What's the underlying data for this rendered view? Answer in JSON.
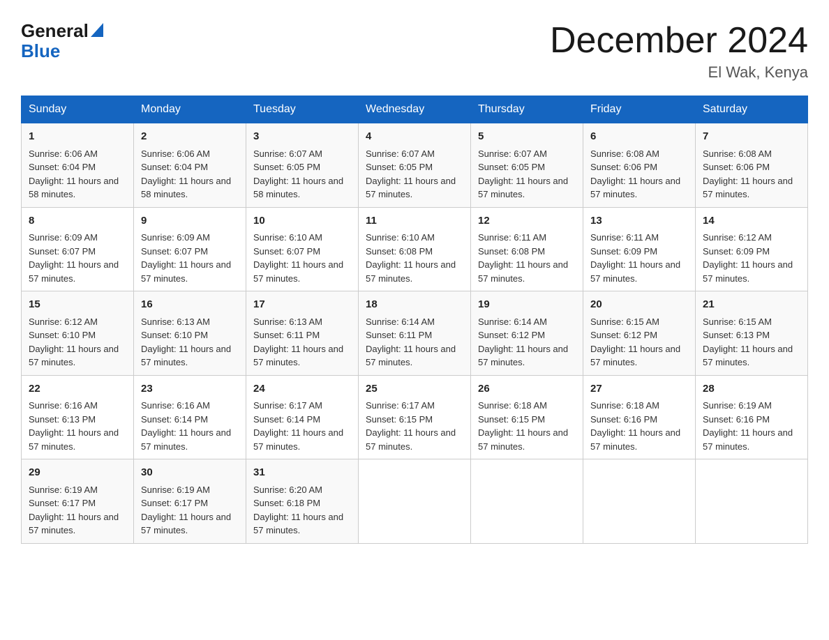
{
  "logo": {
    "general": "General",
    "triangle": "▲",
    "blue": "Blue"
  },
  "title": "December 2024",
  "location": "El Wak, Kenya",
  "days_of_week": [
    "Sunday",
    "Monday",
    "Tuesday",
    "Wednesday",
    "Thursday",
    "Friday",
    "Saturday"
  ],
  "weeks": [
    [
      {
        "day": "1",
        "sunrise": "6:06 AM",
        "sunset": "6:04 PM",
        "daylight": "11 hours and 58 minutes."
      },
      {
        "day": "2",
        "sunrise": "6:06 AM",
        "sunset": "6:04 PM",
        "daylight": "11 hours and 58 minutes."
      },
      {
        "day": "3",
        "sunrise": "6:07 AM",
        "sunset": "6:05 PM",
        "daylight": "11 hours and 58 minutes."
      },
      {
        "day": "4",
        "sunrise": "6:07 AM",
        "sunset": "6:05 PM",
        "daylight": "11 hours and 57 minutes."
      },
      {
        "day": "5",
        "sunrise": "6:07 AM",
        "sunset": "6:05 PM",
        "daylight": "11 hours and 57 minutes."
      },
      {
        "day": "6",
        "sunrise": "6:08 AM",
        "sunset": "6:06 PM",
        "daylight": "11 hours and 57 minutes."
      },
      {
        "day": "7",
        "sunrise": "6:08 AM",
        "sunset": "6:06 PM",
        "daylight": "11 hours and 57 minutes."
      }
    ],
    [
      {
        "day": "8",
        "sunrise": "6:09 AM",
        "sunset": "6:07 PM",
        "daylight": "11 hours and 57 minutes."
      },
      {
        "day": "9",
        "sunrise": "6:09 AM",
        "sunset": "6:07 PM",
        "daylight": "11 hours and 57 minutes."
      },
      {
        "day": "10",
        "sunrise": "6:10 AM",
        "sunset": "6:07 PM",
        "daylight": "11 hours and 57 minutes."
      },
      {
        "day": "11",
        "sunrise": "6:10 AM",
        "sunset": "6:08 PM",
        "daylight": "11 hours and 57 minutes."
      },
      {
        "day": "12",
        "sunrise": "6:11 AM",
        "sunset": "6:08 PM",
        "daylight": "11 hours and 57 minutes."
      },
      {
        "day": "13",
        "sunrise": "6:11 AM",
        "sunset": "6:09 PM",
        "daylight": "11 hours and 57 minutes."
      },
      {
        "day": "14",
        "sunrise": "6:12 AM",
        "sunset": "6:09 PM",
        "daylight": "11 hours and 57 minutes."
      }
    ],
    [
      {
        "day": "15",
        "sunrise": "6:12 AM",
        "sunset": "6:10 PM",
        "daylight": "11 hours and 57 minutes."
      },
      {
        "day": "16",
        "sunrise": "6:13 AM",
        "sunset": "6:10 PM",
        "daylight": "11 hours and 57 minutes."
      },
      {
        "day": "17",
        "sunrise": "6:13 AM",
        "sunset": "6:11 PM",
        "daylight": "11 hours and 57 minutes."
      },
      {
        "day": "18",
        "sunrise": "6:14 AM",
        "sunset": "6:11 PM",
        "daylight": "11 hours and 57 minutes."
      },
      {
        "day": "19",
        "sunrise": "6:14 AM",
        "sunset": "6:12 PM",
        "daylight": "11 hours and 57 minutes."
      },
      {
        "day": "20",
        "sunrise": "6:15 AM",
        "sunset": "6:12 PM",
        "daylight": "11 hours and 57 minutes."
      },
      {
        "day": "21",
        "sunrise": "6:15 AM",
        "sunset": "6:13 PM",
        "daylight": "11 hours and 57 minutes."
      }
    ],
    [
      {
        "day": "22",
        "sunrise": "6:16 AM",
        "sunset": "6:13 PM",
        "daylight": "11 hours and 57 minutes."
      },
      {
        "day": "23",
        "sunrise": "6:16 AM",
        "sunset": "6:14 PM",
        "daylight": "11 hours and 57 minutes."
      },
      {
        "day": "24",
        "sunrise": "6:17 AM",
        "sunset": "6:14 PM",
        "daylight": "11 hours and 57 minutes."
      },
      {
        "day": "25",
        "sunrise": "6:17 AM",
        "sunset": "6:15 PM",
        "daylight": "11 hours and 57 minutes."
      },
      {
        "day": "26",
        "sunrise": "6:18 AM",
        "sunset": "6:15 PM",
        "daylight": "11 hours and 57 minutes."
      },
      {
        "day": "27",
        "sunrise": "6:18 AM",
        "sunset": "6:16 PM",
        "daylight": "11 hours and 57 minutes."
      },
      {
        "day": "28",
        "sunrise": "6:19 AM",
        "sunset": "6:16 PM",
        "daylight": "11 hours and 57 minutes."
      }
    ],
    [
      {
        "day": "29",
        "sunrise": "6:19 AM",
        "sunset": "6:17 PM",
        "daylight": "11 hours and 57 minutes."
      },
      {
        "day": "30",
        "sunrise": "6:19 AM",
        "sunset": "6:17 PM",
        "daylight": "11 hours and 57 minutes."
      },
      {
        "day": "31",
        "sunrise": "6:20 AM",
        "sunset": "6:18 PM",
        "daylight": "11 hours and 57 minutes."
      },
      null,
      null,
      null,
      null
    ]
  ]
}
